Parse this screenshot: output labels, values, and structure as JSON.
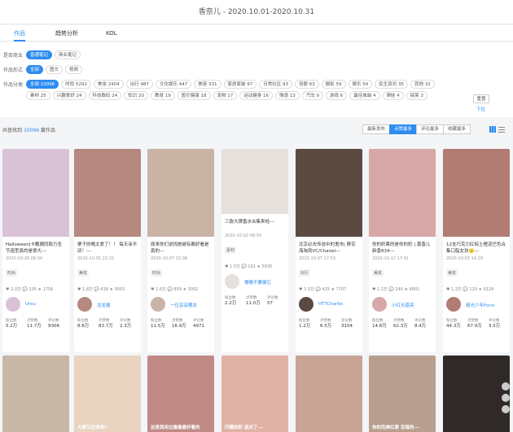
{
  "header": {
    "title": "香奈儿 - 2020.10.01-2020.10.31"
  },
  "tabs": [
    {
      "label": "作品"
    },
    {
      "label": "趋势分析"
    },
    {
      "label": "KOL"
    }
  ],
  "filters": {
    "type": {
      "label": "是否商业",
      "options": [
        "普通笔记",
        "商业笔记"
      ]
    },
    "form": {
      "label": "作品形式",
      "options": [
        "全部",
        "图文",
        "视频"
      ]
    },
    "category": {
      "label": "作品分类",
      "options": [
        "全部 10096",
        "时尚 5292",
        "美妆 2404",
        "出行 987",
        "文化娱乐 447",
        "美容 331",
        "家居家装 97",
        "日常社区 93",
        "母婴 63",
        "摄影 59",
        "娱乐 54",
        "民生资讯 35",
        "其他 32",
        "素材 25",
        "兴趣爱好 24",
        "科技数码 24",
        "知识 20",
        "教育 19",
        "医疗健康 18",
        "宠物 17",
        "运动健身 16",
        "情感 13",
        "汽车 9",
        "游戏 6",
        "最佳单曲 4",
        "萌娃 4",
        "搞笑 3"
      ]
    },
    "reset": "重置",
    "expand": "下拉"
  },
  "result": {
    "prefix": "共查找到",
    "count": "10096",
    "suffix": "篇作品"
  },
  "sorts": [
    "最新发布",
    "点赞最多",
    "评论最多",
    "收藏最多"
  ],
  "cards": [
    {
      "title": "Halloween|卡戴珊同款万圣节造型真的是很大---",
      "date": "2020-10-28 06:34",
      "tag": "时尚",
      "stats": "♥ 2.0万  💬 105  ★ 1756",
      "user": "Urou",
      "m": [
        [
          "粉丝数",
          "5.2万"
        ],
        [
          "点赞数",
          "11.7万"
        ],
        [
          "评论数",
          "9306"
        ]
      ],
      "bg": "#d9c2d6"
    },
    {
      "title": "栗子的嘴太爱了！！ 每天涂不厌！---",
      "date": "2020-10-05 22:22",
      "tag": "美妆",
      "stats": "♥ 1.8万  💬 418  ★ 9563",
      "user": "龙龙酱",
      "m": [
        [
          "粉丝数",
          "8.8万"
        ],
        [
          "点赞数",
          "83.7万"
        ],
        [
          "评论数",
          "2.3万"
        ]
      ],
      "bg": "#b58880"
    },
    {
      "title": "原来你们说找她被有都好看是真的---",
      "date": "2020-10-07 15:06",
      "tag": "时尚",
      "stats": "♥ 1.6万  💬 859  ★ 3092",
      "user": "一位芸芸椰女",
      "m": [
        [
          "粉丝数",
          "11.5万"
        ],
        [
          "点赞数",
          "16.9万"
        ],
        [
          "评论数",
          "4971"
        ]
      ],
      "bg": "#c9b3a5"
    },
    {
      "title": "三款大牌香水合集来啦---",
      "date": "2020-10-10 08:54",
      "tag": "素材",
      "stats": "♥ 1.5万  💬 161  ★ 5935",
      "user": "嘟嘟不要健忘",
      "m": [
        [
          "粉丝数",
          "2.2万"
        ],
        [
          "点赞数",
          "11.0万"
        ],
        [
          "评论数",
          "57"
        ]
      ],
      "bg": "#e6e1dc"
    },
    {
      "title": "北京必去传说中的鬼市| 屏京海淘到VC/Chanel---",
      "date": "2020-10-07 17:53",
      "tag": "出行",
      "stats": "♥ 1.5万  💬 425  ★ 7707",
      "user": "HTTCharlie",
      "m": [
        [
          "粉丝数",
          "1.2万"
        ],
        [
          "点赞数",
          "6.5万"
        ],
        [
          "评论数",
          "3104"
        ]
      ],
      "bg": "#5a4a42"
    },
    {
      "title": "你的奶果的是你的奶 | 黄香儿新香834---",
      "date": "2020-10-12 17:41",
      "tag": "美妆",
      "stats": "♥ 1.2万  💬 240  ★ 6601",
      "user": "小红无惑亮",
      "m": [
        [
          "粉丝数",
          "14.8万"
        ],
        [
          "点赞数",
          "62.3万"
        ],
        [
          "评论数",
          "8.4万"
        ]
      ],
      "bg": "#d8a8a8"
    },
    {
      "title": "12支巧克力红棕土橙泥巴色合集口脂女孩🙂---",
      "date": "2020-10-03 14:29",
      "tag": "美妆",
      "stats": "♥ 1.2万  💬 129  ★ 9129",
      "user": "极光少年Forvi",
      "m": [
        [
          "粉丝数",
          "44.3万"
        ],
        [
          "点赞数",
          "67.9万"
        ],
        [
          "评论数",
          "3.5万"
        ]
      ],
      "bg": "#b07c74"
    }
  ],
  "row2": [
    {
      "title": "",
      "bg": "#c8b6a6"
    },
    {
      "title": "大牌又拉清单?",
      "bg": "#e8d4c0"
    },
    {
      "title": "这是我用过最最最好看的",
      "bg": "#c08a86"
    },
    {
      "title": "闪耀炫彩 选对了---",
      "bg": "#e0b2a6"
    },
    {
      "title": "",
      "bg": "#c9a396"
    },
    {
      "title": "你的完美红唇 没错的---",
      "bg": "#b89e8e"
    },
    {
      "title": "",
      "bg": "#2f2a28"
    }
  ]
}
